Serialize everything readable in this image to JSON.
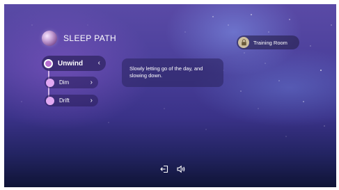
{
  "brand": {
    "title": "SLEEP PATH",
    "icon": "planet-icon"
  },
  "path": {
    "steps": [
      {
        "label": "Unwind",
        "state": "active",
        "chevron": "‹"
      },
      {
        "label": "Dim",
        "state": "idle",
        "chevron": "›"
      },
      {
        "label": "Drift",
        "state": "idle",
        "chevron": "›"
      }
    ]
  },
  "info": {
    "text": "Slowly letting go of the day, and slowing down."
  },
  "training": {
    "label": "Training Room",
    "icon": "lock-icon"
  },
  "footer": {
    "icons": [
      "exit-icon",
      "sound-icon"
    ]
  },
  "colors": {
    "accent": "#e2a9f3",
    "active_dot": "#b86fd0",
    "pill_bg": "#2f2569",
    "lock_bg": "#cdbfa0"
  }
}
